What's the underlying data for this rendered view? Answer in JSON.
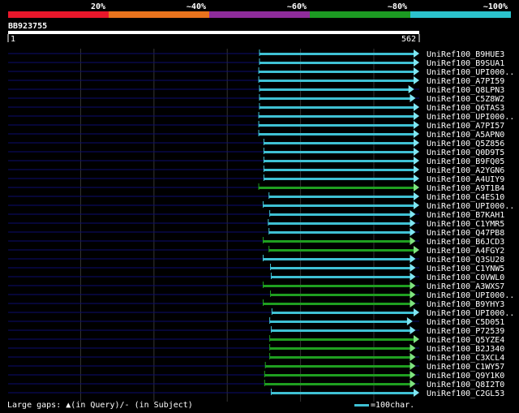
{
  "legend": {
    "labels": [
      "20%",
      "~40%",
      "~60%",
      "~80%",
      "~100%"
    ],
    "colors": [
      "#e8172b",
      "#e8731d",
      "#8e2c9b",
      "#1c9a22",
      "#2bc2cc"
    ]
  },
  "query": {
    "name": "BB923755",
    "start_label": "1",
    "end_label": "562",
    "length": 562
  },
  "colors": {
    "guide": "#0d0d6e",
    "grid": "#333333",
    "green": "#1f9f20",
    "cyan": "#3fc1d4",
    "green_head": "#7ee37e",
    "cyan_head": "#7fe6f2"
  },
  "hits": [
    {
      "name": "UniRef100_B9HUE3",
      "start": 344,
      "end": 562,
      "color": "cyan"
    },
    {
      "name": "UniRef100_B9SUA1",
      "start": 344,
      "end": 562,
      "color": "cyan"
    },
    {
      "name": "UniRef100_UPI000..",
      "start": 343,
      "end": 562,
      "color": "cyan"
    },
    {
      "name": "UniRef100_A7PI59",
      "start": 343,
      "end": 562,
      "color": "cyan"
    },
    {
      "name": "UniRef100_Q8LPN3",
      "start": 344,
      "end": 555,
      "color": "cyan"
    },
    {
      "name": "UniRef100_C5Z8W2",
      "start": 344,
      "end": 557,
      "color": "cyan"
    },
    {
      "name": "UniRef100_Q6TAS3",
      "start": 344,
      "end": 562,
      "color": "cyan"
    },
    {
      "name": "UniRef100_UPI000..",
      "start": 343,
      "end": 562,
      "color": "cyan"
    },
    {
      "name": "UniRef100_A7PI57",
      "start": 343,
      "end": 562,
      "color": "cyan"
    },
    {
      "name": "UniRef100_A5APN0",
      "start": 343,
      "end": 562,
      "color": "cyan"
    },
    {
      "name": "UniRef100_Q5Z856",
      "start": 350,
      "end": 562,
      "color": "cyan"
    },
    {
      "name": "UniRef100_Q0D9T5",
      "start": 350,
      "end": 562,
      "color": "cyan"
    },
    {
      "name": "UniRef100_B9FQ05",
      "start": 350,
      "end": 562,
      "color": "cyan"
    },
    {
      "name": "UniRef100_A2YGN6",
      "start": 350,
      "end": 562,
      "color": "cyan"
    },
    {
      "name": "UniRef100_A4UIY9",
      "start": 350,
      "end": 562,
      "color": "cyan"
    },
    {
      "name": "UniRef100_A9T1B4",
      "start": 343,
      "end": 562,
      "color": "green"
    },
    {
      "name": "UniRef100_C4ES10",
      "start": 357,
      "end": 562,
      "color": "cyan"
    },
    {
      "name": "UniRef100_UPI000..",
      "start": 349,
      "end": 562,
      "color": "cyan"
    },
    {
      "name": "UniRef100_B7KAH1",
      "start": 358,
      "end": 557,
      "color": "cyan"
    },
    {
      "name": "UniRef100_C1YMR5",
      "start": 356,
      "end": 557,
      "color": "cyan"
    },
    {
      "name": "UniRef100_Q47PB8",
      "start": 357,
      "end": 557,
      "color": "cyan"
    },
    {
      "name": "UniRef100_B6JCD3",
      "start": 349,
      "end": 557,
      "color": "green"
    },
    {
      "name": "UniRef100_A4FGY2",
      "start": 357,
      "end": 562,
      "color": "green"
    },
    {
      "name": "UniRef100_Q3SU28",
      "start": 349,
      "end": 557,
      "color": "cyan"
    },
    {
      "name": "UniRef100_C1YNW5",
      "start": 359,
      "end": 557,
      "color": "cyan"
    },
    {
      "name": "UniRef100_C0VWL0",
      "start": 360,
      "end": 557,
      "color": "cyan"
    },
    {
      "name": "UniRef100_A3WXS7",
      "start": 349,
      "end": 557,
      "color": "green"
    },
    {
      "name": "UniRef100_UPI000..",
      "start": 359,
      "end": 557,
      "color": "green"
    },
    {
      "name": "UniRef100_B9YHY3",
      "start": 349,
      "end": 557,
      "color": "green"
    },
    {
      "name": "UniRef100_UPI000..",
      "start": 361,
      "end": 562,
      "color": "cyan"
    },
    {
      "name": "UniRef100_C5D051",
      "start": 358,
      "end": 553,
      "color": "cyan"
    },
    {
      "name": "UniRef100_P72539",
      "start": 360,
      "end": 557,
      "color": "cyan"
    },
    {
      "name": "UniRef100_Q5YZE4",
      "start": 358,
      "end": 562,
      "color": "green"
    },
    {
      "name": "UniRef100_B2J340",
      "start": 358,
      "end": 557,
      "color": "green"
    },
    {
      "name": "UniRef100_C3XCL4",
      "start": 358,
      "end": 557,
      "color": "green"
    },
    {
      "name": "UniRef100_C1WY57",
      "start": 352,
      "end": 557,
      "color": "green"
    },
    {
      "name": "UniRef100_Q9Y1K0",
      "start": 351,
      "end": 557,
      "color": "green"
    },
    {
      "name": "UniRef100_Q8I2T0",
      "start": 351,
      "end": 557,
      "color": "green"
    },
    {
      "name": "UniRef100_C2GL53",
      "start": 360,
      "end": 562,
      "color": "cyan"
    }
  ],
  "footer": {
    "gaps_label": "Large gaps:",
    "gaps_query": "(in Query)/",
    "gaps_query_symbol": "▲",
    "gaps_subject": "- (in Subject)",
    "scale_text": "=100char."
  }
}
